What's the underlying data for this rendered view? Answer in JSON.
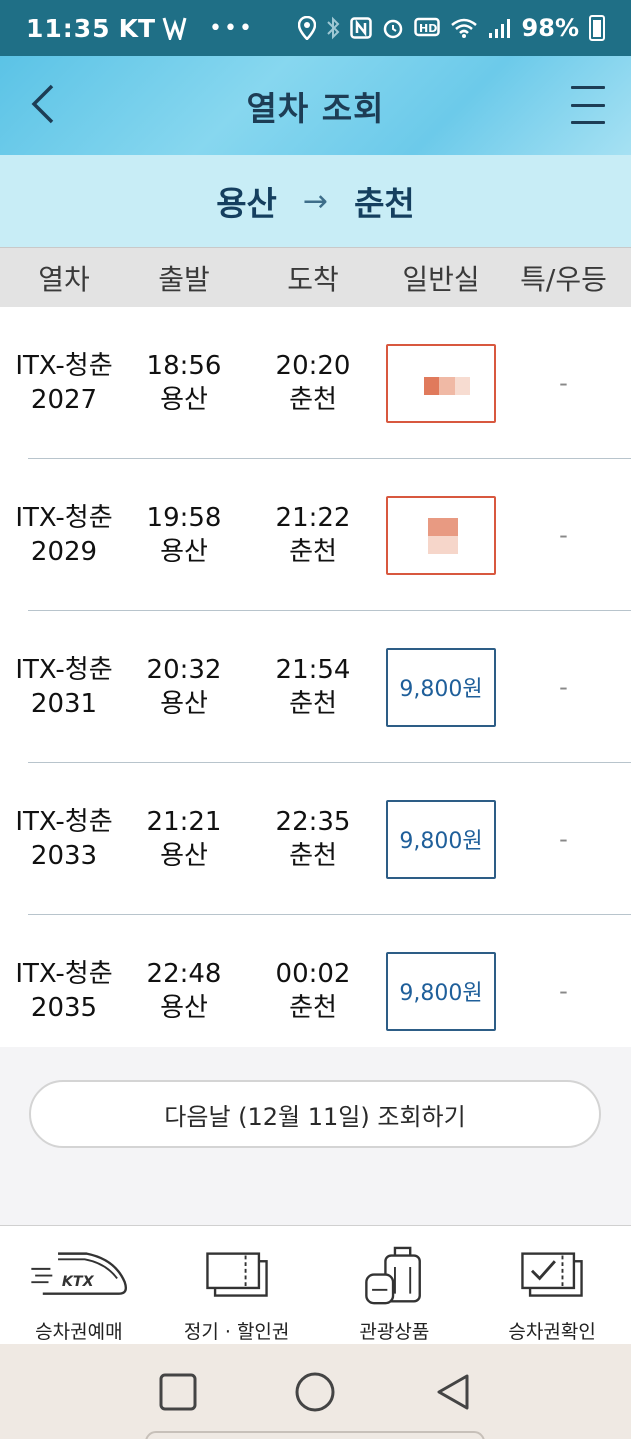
{
  "status_bar": {
    "time": "11:35",
    "carrier": "KT",
    "battery": "98%"
  },
  "header": {
    "title": "열차 조회"
  },
  "route": {
    "from": "용산",
    "arrow": "→",
    "to": "춘천"
  },
  "columns": [
    "열차",
    "출발",
    "도착",
    "일반실",
    "특/우등"
  ],
  "trains": [
    {
      "train": "ITX-청춘",
      "number": "2027",
      "dep_time": "18:56",
      "dep_station": "용산",
      "arr_time": "20:20",
      "arr_station": "춘천",
      "fare": "",
      "fare_state": "sold_out",
      "first": "-"
    },
    {
      "train": "ITX-청춘",
      "number": "2029",
      "dep_time": "19:58",
      "dep_station": "용산",
      "arr_time": "21:22",
      "arr_station": "춘천",
      "fare": "",
      "fare_state": "sold_out",
      "first": "-"
    },
    {
      "train": "ITX-청춘",
      "number": "2031",
      "dep_time": "20:32",
      "dep_station": "용산",
      "arr_time": "21:54",
      "arr_station": "춘천",
      "fare": "9,800원",
      "fare_state": "available",
      "first": "-"
    },
    {
      "train": "ITX-청춘",
      "number": "2033",
      "dep_time": "21:21",
      "dep_station": "용산",
      "arr_time": "22:35",
      "arr_station": "춘천",
      "fare": "9,800원",
      "fare_state": "available",
      "first": "-"
    },
    {
      "train": "ITX-청춘",
      "number": "2035",
      "dep_time": "22:48",
      "dep_station": "용산",
      "arr_time": "00:02",
      "arr_station": "춘천",
      "fare": "9,800원",
      "fare_state": "available",
      "first": "-"
    }
  ],
  "next_day_button": "다음날 (12월 11일) 조회하기",
  "bottom_nav": [
    {
      "label": "승차권예매",
      "icon": "ktx-train-icon",
      "badge": "KTX"
    },
    {
      "label": "정기 · 할인권",
      "icon": "ticket-icon"
    },
    {
      "label": "관광상품",
      "icon": "luggage-icon"
    },
    {
      "label": "승차권확인",
      "icon": "ticket-check-icon"
    }
  ],
  "colors": {
    "status_bar": "#1f6f86",
    "header_title": "#1d3d55",
    "route_band": "#c8edf6",
    "fare_border": "#2d5d86",
    "fare_text": "#1f5f9a",
    "sold_out_border": "#d8583f"
  }
}
